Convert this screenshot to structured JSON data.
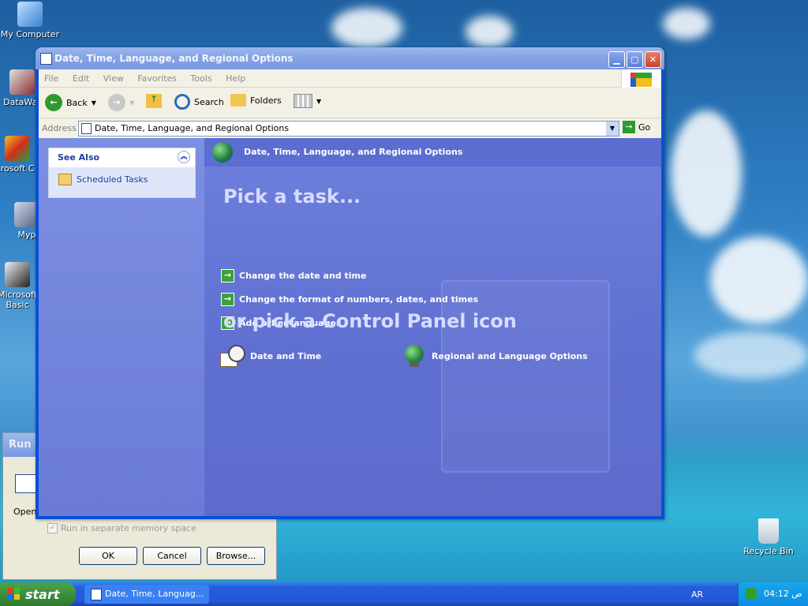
{
  "desktop": {
    "icons": [
      {
        "label": "My Computer"
      },
      {
        "label": "DataWar"
      },
      {
        "label": "Microsoft C++"
      },
      {
        "label": "Myp"
      },
      {
        "label": "Microsoft Basic"
      },
      {
        "label": "Recycle Bin"
      }
    ]
  },
  "run_dialog": {
    "title": "Run",
    "open_label": "Open",
    "checkbox_label": "Run in separate memory space",
    "checkbox_checked": true,
    "ok_label": "OK",
    "cancel_label": "Cancel",
    "browse_label": "Browse..."
  },
  "window": {
    "title": "Date, Time, Language, and Regional Options",
    "menu": [
      "File",
      "Edit",
      "View",
      "Favorites",
      "Tools",
      "Help"
    ],
    "toolbar": {
      "back_label": "Back",
      "search_label": "Search",
      "folders_label": "Folders"
    },
    "address": {
      "label": "Address",
      "value": "Date, Time, Language, and Regional Options",
      "go_label": "Go"
    },
    "see_also": {
      "header": "See Also",
      "items": [
        {
          "label": "Scheduled Tasks"
        }
      ]
    },
    "header": "Date, Time, Language, and Regional Options",
    "pick_task_heading": "Pick a task...",
    "tasks": [
      {
        "label": "Change the date and time"
      },
      {
        "label": "Change the format of numbers, dates, and times"
      },
      {
        "label": "Add other languages"
      }
    ],
    "pick_icon_heading": "or pick a Control Panel icon",
    "icons": [
      {
        "label": "Date and Time",
        "icon": "clock-calendar-icon"
      },
      {
        "label": "Regional and Language Options",
        "icon": "globe-icon"
      }
    ]
  },
  "taskbar": {
    "start_label": "start",
    "task_button": "Date, Time, Languag...",
    "language": "AR",
    "clock": "04:12 ص"
  },
  "colors": {
    "xp_blue": "#245edb",
    "panel_blue": "#6373d0",
    "start_green": "#3c8f3c"
  }
}
